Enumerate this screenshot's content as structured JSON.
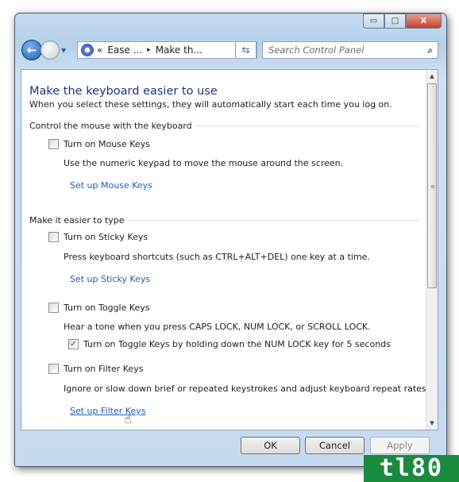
{
  "window": {
    "controls": {
      "minimize": "▭",
      "maximize": "□",
      "close": "X"
    }
  },
  "address": {
    "breadcrumbs": [
      "«",
      "Ease ...",
      "▸",
      "Make th..."
    ],
    "dropdown": "▾",
    "refresh_icon": "refresh-icon"
  },
  "search": {
    "placeholder": "Search Control Panel",
    "icon": "search-icon"
  },
  "page": {
    "title": "Make the keyboard easier to use",
    "subtitle": "When you select these settings, they will automatically start each time you log on.",
    "groups": [
      {
        "heading": "Control the mouse with the keyboard"
      },
      {
        "heading": "Make it easier to type"
      }
    ],
    "options": [
      {
        "label": "Turn on Mouse Keys",
        "checked": false,
        "description": "Use the numeric keypad to move the mouse around the screen.",
        "link": "Set up Mouse Keys"
      },
      {
        "label": "Turn on Sticky Keys",
        "checked": false,
        "description": "Press keyboard shortcuts (such as CTRL+ALT+DEL) one key at a time.",
        "link": "Set up Sticky Keys"
      },
      {
        "label": "Turn on Toggle Keys",
        "checked": false,
        "description": "Hear a tone when you press CAPS LOCK, NUM LOCK, or SCROLL LOCK.",
        "sub_option": {
          "label": "Turn on Toggle Keys by holding down the NUM LOCK key for 5 seconds",
          "checked": true
        }
      },
      {
        "label": "Turn on Filter Keys",
        "checked": false,
        "description": "Ignore or slow down brief or repeated keystrokes and adjust keyboard repeat rates.",
        "link": "Set up Filter Keys"
      }
    ]
  },
  "buttons": {
    "ok": "OK",
    "cancel": "Cancel",
    "apply": "Apply",
    "apply_enabled": false
  },
  "watermark": "tl80",
  "check_mark": "✓"
}
